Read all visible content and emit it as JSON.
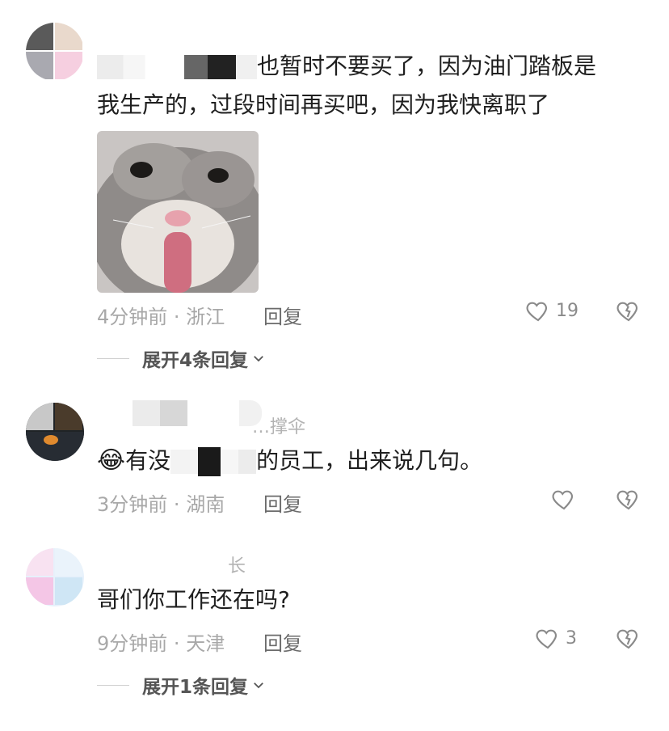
{
  "comments": [
    {
      "username": "",
      "text_line1_visible": "也暂时不要买了，因为油门踏板是",
      "text_line2": "我生产的，过段时间再买吧，因为我快离职了",
      "time": "4分钟前",
      "location": "浙江",
      "reply_label": "回复",
      "likes": "19",
      "expand_label": "展开4条回复",
      "sticker": "cat-tongue-sticker"
    },
    {
      "username": "…撑伞",
      "emoji": "😂",
      "text_prefix": "有没",
      "text_suffix": "的员工，出来说几句。",
      "time": "3分钟前",
      "location": "湖南",
      "reply_label": "回复",
      "likes": ""
    },
    {
      "username": "长",
      "text": "哥们你工作还在吗?",
      "time": "9分钟前",
      "location": "天津",
      "reply_label": "回复",
      "likes": "3",
      "expand_label": "展开1条回复"
    }
  ],
  "meta_separator": "·",
  "colors": {
    "text": "#1f1f1f",
    "meta": "#a8a8a8",
    "reply": "#6b6b6b",
    "icon": "#8a8a8a"
  }
}
